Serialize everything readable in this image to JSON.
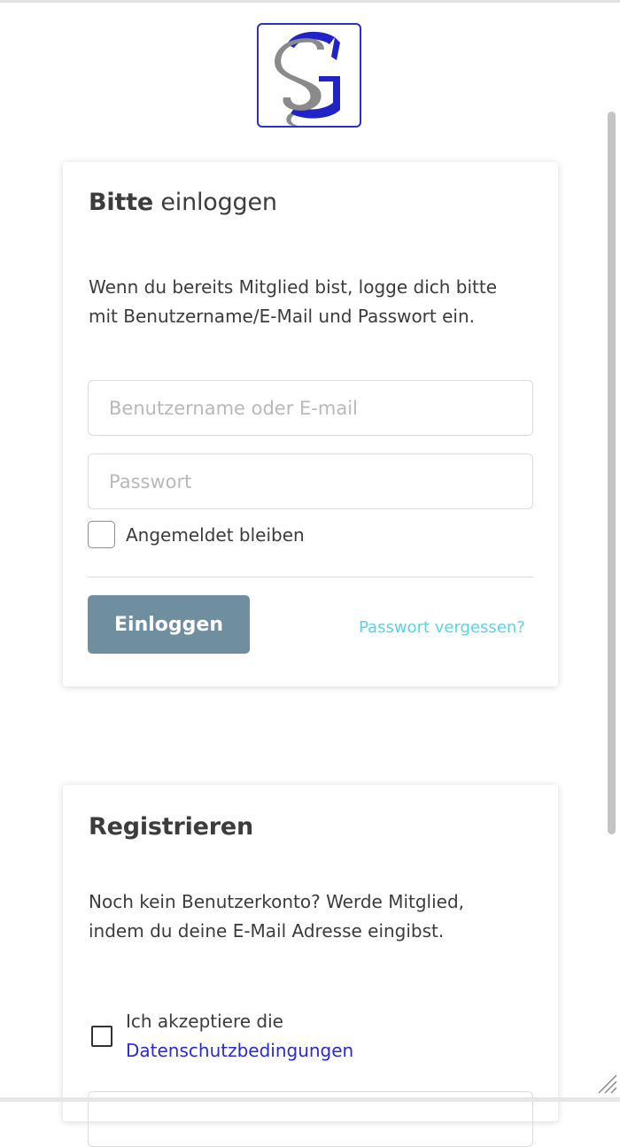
{
  "brand": {
    "logo_name": "SG monogram logo",
    "colors": {
      "logo_blue": "#2b2fd0",
      "button": "#6f8fa1",
      "link_cyan": "#5ad3e5",
      "link_blue": "#2a2ad6"
    }
  },
  "login": {
    "title_bold": "Bitte",
    "title_rest": " einloggen",
    "intro": "Wenn du bereits Mitglied bist, logge dich bitte mit Benutzername/E-Mail und Passwort ein.",
    "username_placeholder": "Benutzername oder E-mail",
    "username_value": "",
    "password_placeholder": "Passwort",
    "password_value": "",
    "remember_label": "Angemeldet bleiben",
    "remember_checked": false,
    "submit_label": "Einloggen",
    "forgot_label": "Passwort vergessen?"
  },
  "register": {
    "title": "Registrieren",
    "intro": "Noch kein Benutzerkonto? Werde Mitglied, indem du deine E-Mail Adresse eingibst.",
    "accept_label": "Ich akzeptiere die",
    "privacy_link": "Datenschutzbedingungen",
    "accept_checked": false
  },
  "icons": {
    "logo": "sg-logo-icon",
    "resize": "resize-grip-icon"
  }
}
